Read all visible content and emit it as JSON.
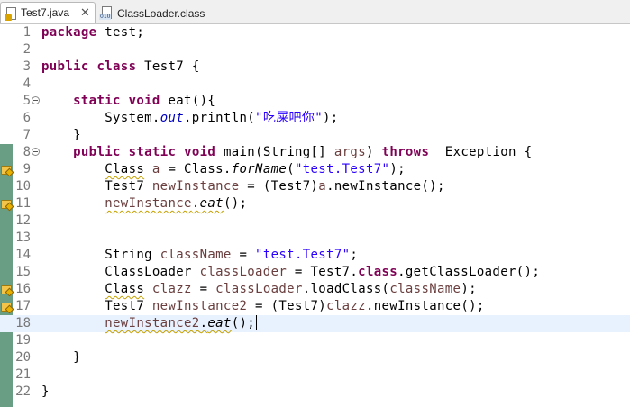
{
  "tabs": [
    {
      "label": "Test7.java",
      "active": true,
      "icon": "java-file-icon",
      "closable": true
    },
    {
      "label": "ClassLoader.class",
      "active": false,
      "icon": "class-file-icon"
    }
  ],
  "close_glyph": "✕",
  "editor": {
    "current_line": 18,
    "line_numbers": [
      "1",
      "2",
      "3",
      "4",
      "5",
      "6",
      "7",
      "8",
      "9",
      "10",
      "11",
      "12",
      "13",
      "14",
      "15",
      "16",
      "17",
      "18",
      "19",
      "20",
      "21",
      "22"
    ],
    "code": {
      "l1_kw": "package",
      "l1_rest": " test;",
      "l3_kw1": "public",
      "l3_kw2": "class",
      "l3_rest": " Test7 {",
      "l5_indent": "    ",
      "l5_kw1": "static",
      "l5_kw2": "void",
      "l5_rest": " eat(){",
      "l6_a": "        System.",
      "l6_field": "out",
      "l6_b": ".println(",
      "l6_str": "\"吃屎吧你\"",
      "l6_c": ");",
      "l7": "    }",
      "l8_indent": "    ",
      "l8_kw1": "public",
      "l8_kw2": "static",
      "l8_kw3": "void",
      "l8_a": " main(String[] ",
      "l8_var": "args",
      "l8_b": ") ",
      "l8_kw4": "throws",
      "l8_c": "  Exception {",
      "l9_indent": "        ",
      "l9_warn": "Class",
      "l9_a": " ",
      "l9_var": "a",
      "l9_b": " = Class.",
      "l9_ital": "forName",
      "l9_c": "(",
      "l9_str": "\"test.Test7\"",
      "l9_d": ");",
      "l10_a": "        Test7 ",
      "l10_var": "newInstance",
      "l10_b": " = (Test7)",
      "l10_var2": "a",
      "l10_c": ".newInstance();",
      "l11_indent": "        ",
      "l11_var": "newInstance",
      "l11_a": ".",
      "l11_ital": "eat",
      "l11_b": "();",
      "l14_a": "        String ",
      "l14_var": "className",
      "l14_b": " = ",
      "l14_str": "\"test.Test7\"",
      "l14_c": ";",
      "l15_a": "        ClassLoader ",
      "l15_var": "classLoader",
      "l15_b": " = Test7.",
      "l15_kw": "class",
      "l15_c": ".getClassLoader();",
      "l16_indent": "        ",
      "l16_warn": "Class",
      "l16_a": " ",
      "l16_var": "clazz",
      "l16_b": " = ",
      "l16_var2": "classLoader",
      "l16_c": ".loadClass(",
      "l16_var3": "className",
      "l16_d": ");",
      "l17_a": "        Test7 ",
      "l17_var": "newInstance2",
      "l17_b": " = (Test7)",
      "l17_var2": "clazz",
      "l17_c": ".newInstance();",
      "l18_indent": "        ",
      "l18_var": "newInstance2",
      "l18_a": ".",
      "l18_ital": "eat",
      "l18_b": "();",
      "l20": "    }",
      "l22": "}"
    }
  },
  "colors": {
    "keyword": "#7f0055",
    "string": "#2a00ff",
    "field": "#0000c0",
    "variable": "#6a3e3e",
    "warning_underline": "#c5a000",
    "current_line": "#e8f2fe",
    "change_bar": "#6a9e84"
  }
}
